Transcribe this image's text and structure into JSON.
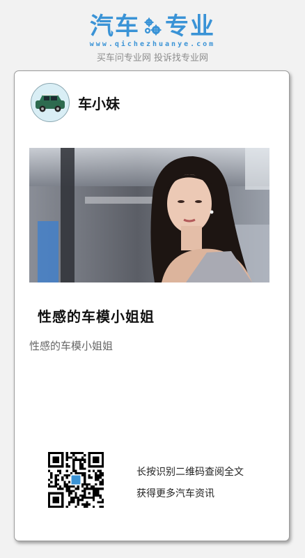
{
  "header": {
    "logo_left": "汽车",
    "logo_right": "专业",
    "logo_icon": "gear-icon",
    "logo_url": "www.qichezhuanye.com",
    "tagline": "买车问专业网 投诉找专业网",
    "brand_color": "#3a93d6"
  },
  "card": {
    "author": {
      "name": "车小妹",
      "avatar_icon": "green-car-icon"
    },
    "photo": {
      "subject": "car-show-model-photo"
    },
    "article": {
      "title": "性感的车模小姐姐",
      "summary": "性感的车模小姐姐"
    },
    "qr": {
      "icon": "qr-code-icon",
      "line1": "长按识别二维码查阅全文",
      "line2": "获得更多汽车资讯"
    }
  }
}
